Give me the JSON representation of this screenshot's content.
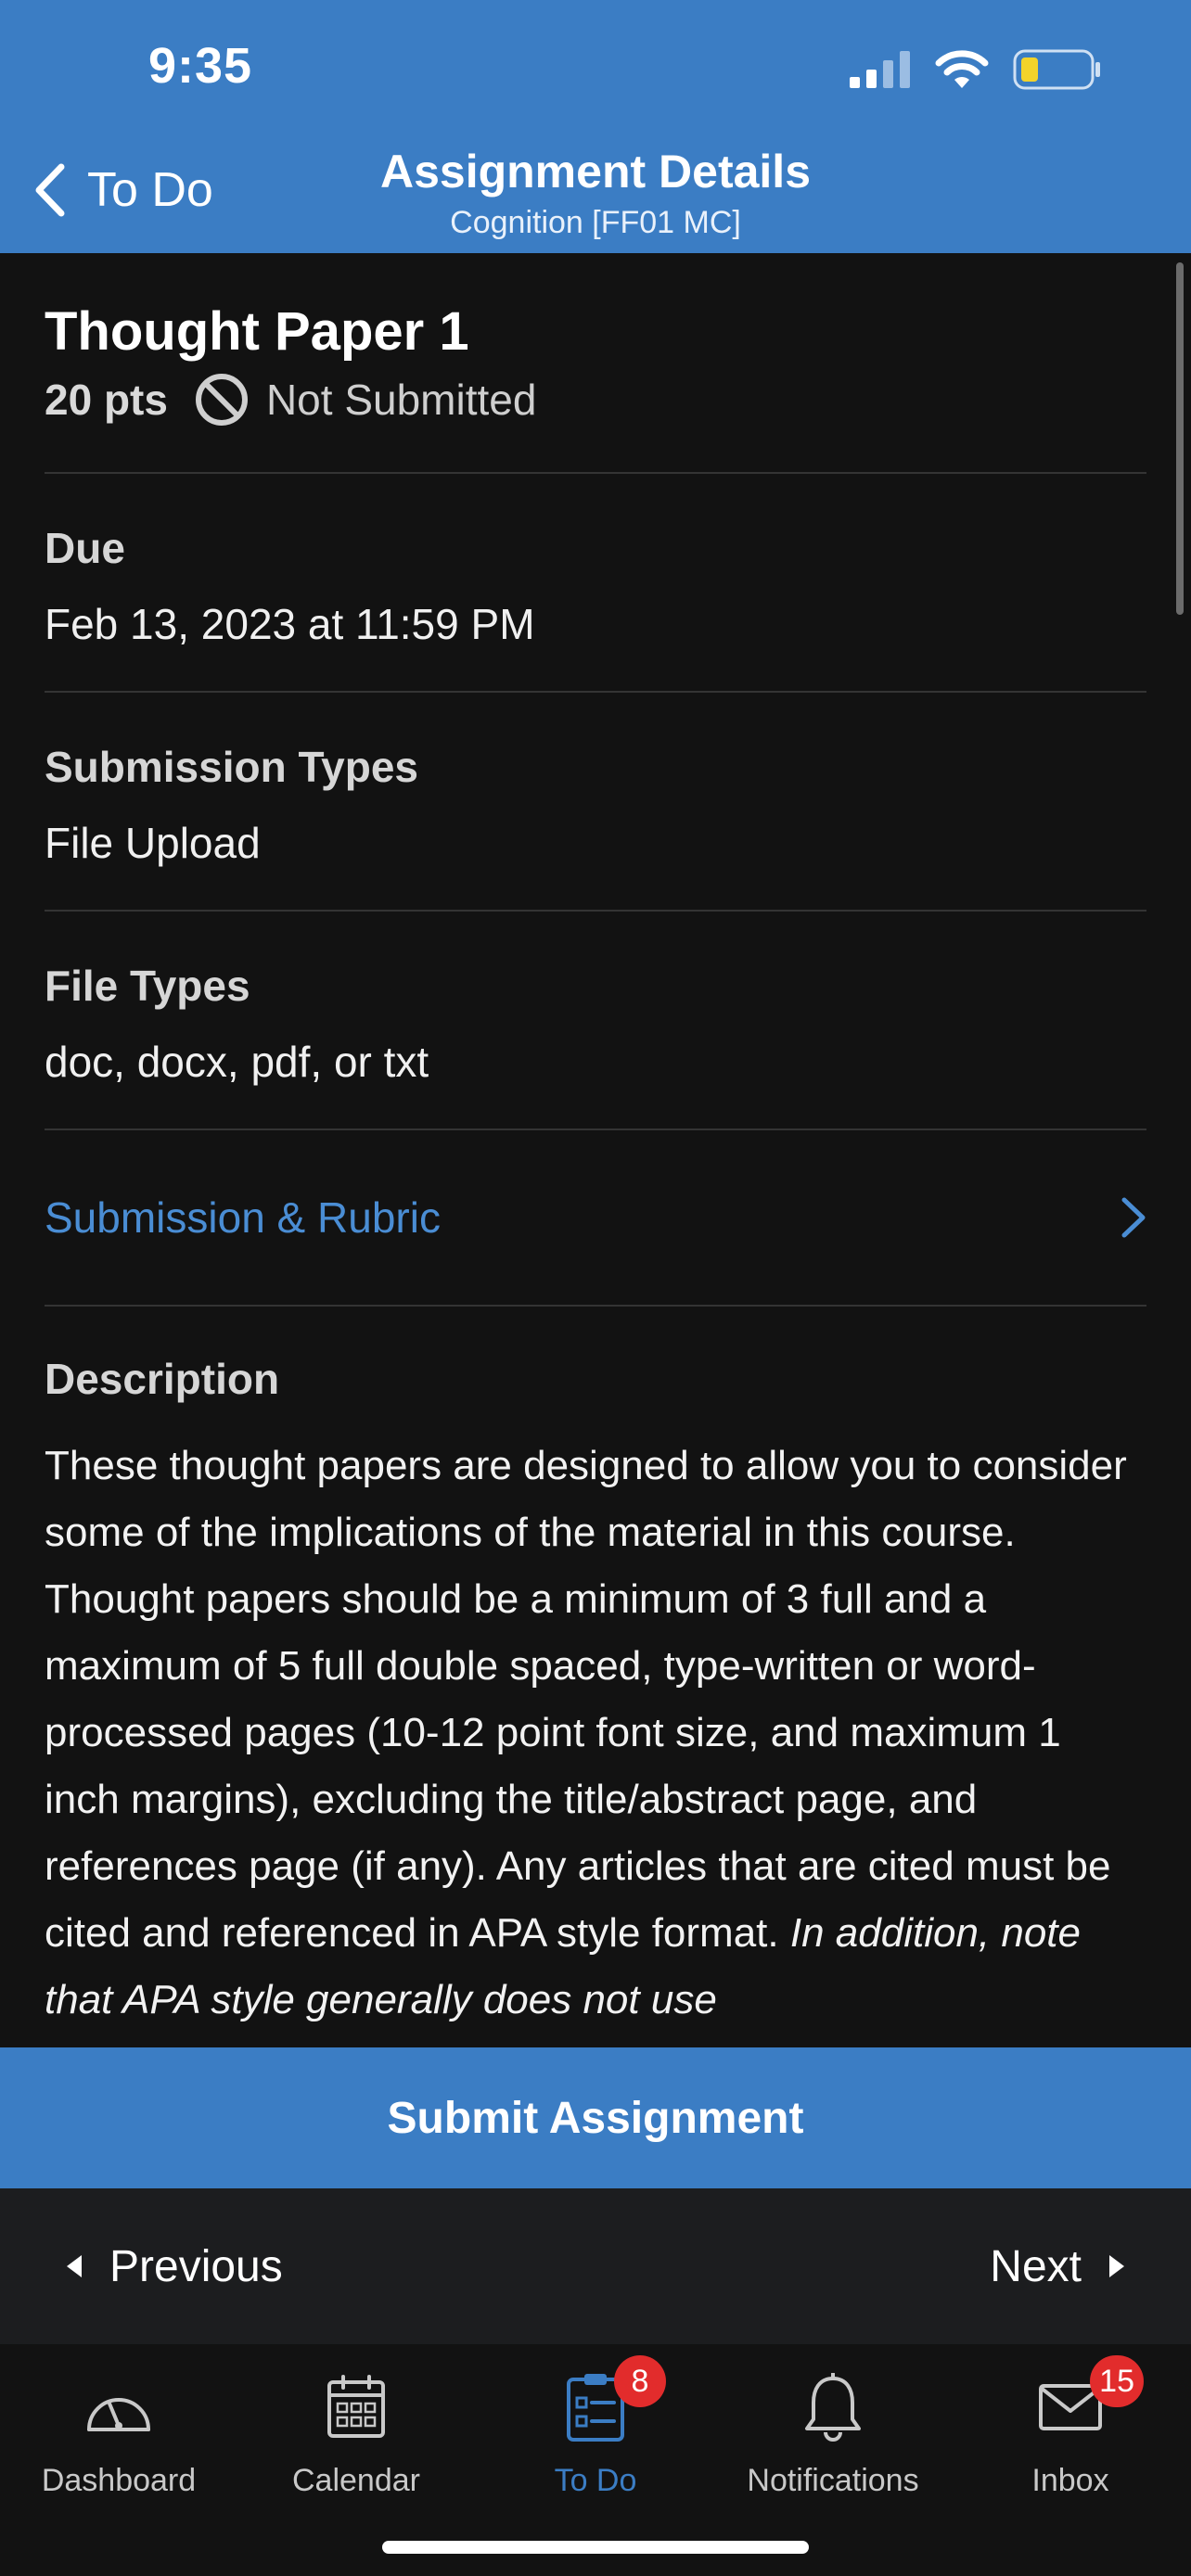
{
  "status_bar": {
    "time": "9:35"
  },
  "nav": {
    "back_label": "To Do",
    "title": "Assignment Details",
    "subtitle": "Cognition [FF01  MC]"
  },
  "assignment": {
    "title": "Thought Paper 1",
    "points": "20 pts",
    "status": "Not Submitted",
    "due_label": "Due",
    "due_value": "Feb 13, 2023 at 11:59 PM",
    "submission_types_label": "Submission Types",
    "submission_types_value": "File Upload",
    "file_types_label": "File Types",
    "file_types_value": "doc, docx, pdf, or txt",
    "rubric_link": "Submission & Rubric",
    "description_label": "Description",
    "description_text": "These thought papers are designed to allow you to consider some of the implications of the material in this course. Thought papers should be a minimum of 3 full and a maximum of 5 full double spaced, type-written or word-processed pages (10-12 point font size, and maximum 1 inch margins), excluding the title/abstract page, and references page (if any). Any articles that are cited must be cited and referenced in APA style format.",
    "description_italic": "In addition, note that APA style generally does not use"
  },
  "actions": {
    "submit_label": "Submit Assignment",
    "previous_label": "Previous",
    "next_label": "Next"
  },
  "tabbar": {
    "items": [
      {
        "label": "Dashboard",
        "icon": "dashboard-icon"
      },
      {
        "label": "Calendar",
        "icon": "calendar-icon"
      },
      {
        "label": "To Do",
        "icon": "todo-icon",
        "badge": "8",
        "active": true
      },
      {
        "label": "Notifications",
        "icon": "bell-icon"
      },
      {
        "label": "Inbox",
        "icon": "mail-icon",
        "badge": "15"
      }
    ]
  },
  "colors": {
    "brand_blue": "#3b7dc4",
    "link_blue": "#4a8dd4",
    "badge_red": "#e22c2c",
    "background": "#121212"
  }
}
